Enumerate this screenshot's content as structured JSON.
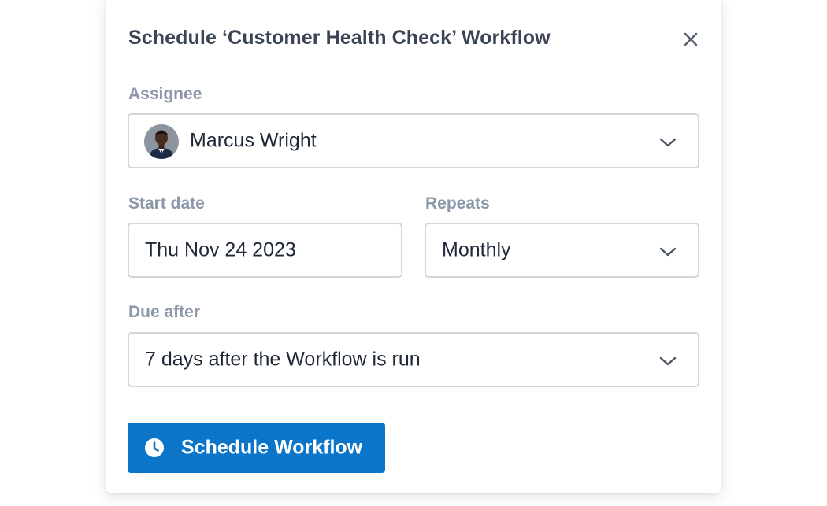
{
  "dialog": {
    "title": "Schedule ‘Customer Health Check’ Workflow",
    "close_icon": "close-icon"
  },
  "assignee": {
    "label": "Assignee",
    "value": "Marcus Wright",
    "avatar": "avatar-photo"
  },
  "start_date": {
    "label": "Start date",
    "value": "Thu Nov 24 2023"
  },
  "repeats": {
    "label": "Repeats",
    "value": "Monthly"
  },
  "due_after": {
    "label": "Due after",
    "value": "7 days after the Workflow is run"
  },
  "submit": {
    "label": "Schedule Workflow",
    "icon": "clock-icon"
  },
  "colors": {
    "primary": "#0a75c9",
    "title_text": "#3b4455",
    "label_text": "#8c98a9",
    "border": "#d2d7de"
  }
}
